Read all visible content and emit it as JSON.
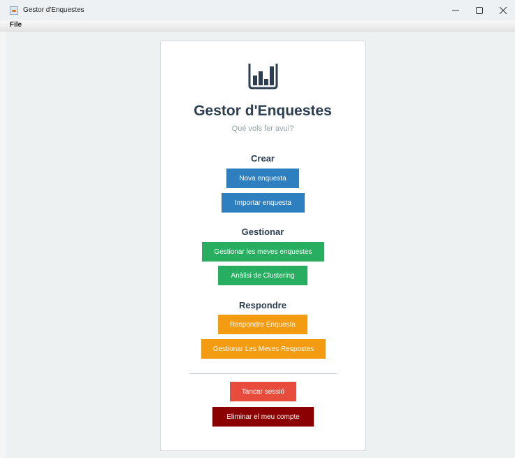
{
  "window": {
    "title": "Gestor d'Enquestes"
  },
  "menubar": {
    "file": "File"
  },
  "header": {
    "title": "Gestor d'Enquestes",
    "subtitle": "Qué vols fer avui?"
  },
  "sections": {
    "crear": {
      "title": "Crear",
      "nova_enquesta": "Nova enquesta",
      "importar_enquesta": "Importar enquesta"
    },
    "gestionar": {
      "title": "Gestionar",
      "gestionar_enquestes": "Gestionar les meves enquestes",
      "analisi_clustering": "Anàlisi de Clustering"
    },
    "respondre": {
      "title": "Respondre",
      "respondre_enquesta": "Respondre Enquesta",
      "gestionar_respostes": "Gestionar Les Meves Respostes"
    }
  },
  "account": {
    "tancar_sessio": "Tancar sessió",
    "eliminar_compte": "Eliminar el meu compte"
  },
  "colors": {
    "blue": "#2e7fbf",
    "green": "#27ae60",
    "orange": "#f39c12",
    "red": "#e74c3c",
    "dark_red": "#8b0000",
    "title": "#2c3e50",
    "subtitle": "#95a5a6"
  },
  "icons": {
    "logo": "bar-chart-icon",
    "app": "java-app-icon",
    "minimize": "minimize-icon",
    "maximize": "maximize-icon",
    "close": "close-icon"
  }
}
